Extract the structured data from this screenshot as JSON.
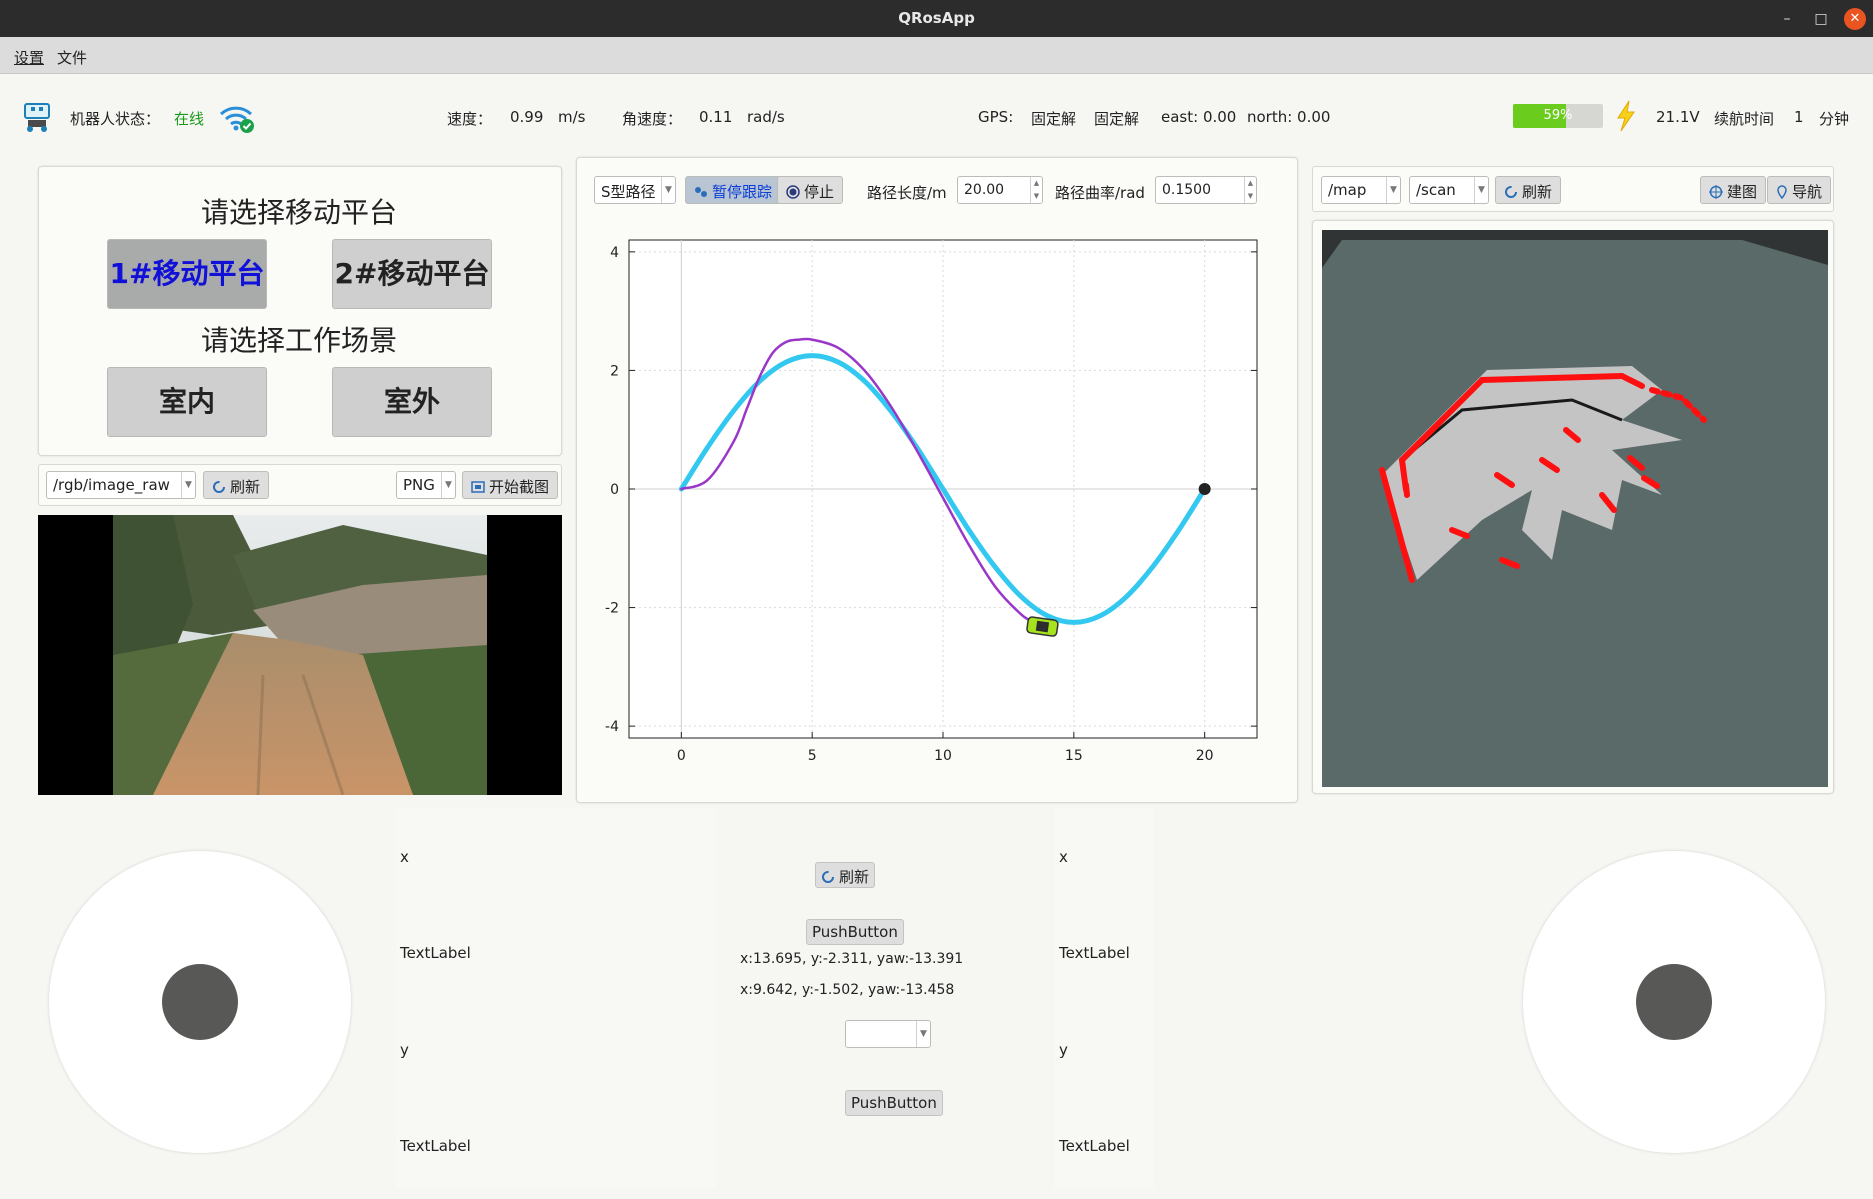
{
  "window": {
    "title": "QRosApp"
  },
  "menu": {
    "settings": "设置",
    "file": "文件"
  },
  "status": {
    "robot_state_label": "机器人状态：",
    "robot_state_value": "在线",
    "speed_label": "速度：",
    "speed_value": "0.99",
    "speed_unit": "m/s",
    "angular_label": "角速度：",
    "angular_value": "0.11",
    "angular_unit": "rad/s",
    "gps_label": "GPS:",
    "gps_fix1": "固定解",
    "gps_fix2": "固定解",
    "east": "east: 0.00",
    "north": "north: 0.00",
    "battery_percent": 59,
    "battery_text": "59%",
    "voltage": "21.1V",
    "endurance_label": "续航时间",
    "endurance_value": "1",
    "endurance_unit": "分钟",
    "online_color": "#1a9a1a",
    "battery_color": "#6acd1e"
  },
  "platform": {
    "heading": "请选择移动平台",
    "btn1": "1#移动平台",
    "btn2": "2#移动平台",
    "scene_heading": "请选择工作场景",
    "indoor": "室内",
    "outdoor": "室外"
  },
  "camera": {
    "topic": "/rgb/image_raw",
    "refresh": "刷新",
    "format": "PNG",
    "screenshot": "开始截图"
  },
  "path": {
    "type": "S型路径",
    "pause": "暂停跟踪",
    "stop": "停止",
    "length_label": "路径长度/m",
    "length_value": "20.00",
    "curvature_label": "路径曲率/rad",
    "curvature_value": "0.1500"
  },
  "chart_data": {
    "type": "line",
    "title": "",
    "xlabel": "",
    "ylabel": "",
    "xlim": [
      -2,
      22
    ],
    "ylim": [
      -4.2,
      4.2
    ],
    "xticks": [
      0,
      5,
      10,
      15,
      20
    ],
    "yticks": [
      4,
      2,
      0,
      -2,
      -4
    ],
    "xtick_labels": [
      "0",
      "5",
      "10",
      "15",
      "20"
    ],
    "ytick_labels": [
      "4",
      "2",
      "0",
      "-2",
      "-4"
    ],
    "grid": true,
    "series": [
      {
        "color": "#33c8f0",
        "x": [
          0,
          1,
          2,
          3,
          4,
          5,
          6,
          7,
          8,
          9,
          10,
          11,
          12,
          13,
          14,
          15,
          16,
          17,
          18,
          19,
          20
        ],
        "y": [
          0,
          0.7,
          1.32,
          1.82,
          2.14,
          2.25,
          2.14,
          1.82,
          1.32,
          0.7,
          0,
          -0.7,
          -1.32,
          -1.82,
          -2.14,
          -2.25,
          -2.14,
          -1.82,
          -1.32,
          -0.7,
          0
        ]
      },
      {
        "color": "#9a36c8",
        "x": [
          0,
          1,
          2,
          2.5,
          3,
          3.5,
          4,
          4.5,
          5,
          6,
          7,
          8,
          9,
          10,
          11,
          12,
          13,
          13.5
        ],
        "y": [
          0,
          0.15,
          0.8,
          1.35,
          1.9,
          2.3,
          2.48,
          2.52,
          2.52,
          2.38,
          2.0,
          1.4,
          0.65,
          -0.15,
          -0.95,
          -1.65,
          -2.12,
          -2.25
        ]
      }
    ],
    "points": [
      {
        "x": 20,
        "y": 0,
        "color": "#222222"
      },
      {
        "x": 13.8,
        "y": -2.32,
        "color": "#a6e21e",
        "label": "robot"
      }
    ]
  },
  "map": {
    "topic1": "/map",
    "topic2": "/scan",
    "refresh": "刷新",
    "build": "建图",
    "navigate": "导航",
    "bg_color": "#5a6a69"
  },
  "controls": {
    "x_left": "x",
    "label_left1": "TextLabel",
    "y_left": "y",
    "label_left2": "TextLabel",
    "x_right": "x",
    "label_right1": "TextLabel",
    "y_right": "y",
    "label_right2": "TextLabel",
    "refresh": "刷新",
    "pushbutton1": "PushButton",
    "pose1": "x:13.695, y:-2.311, yaw:-13.391",
    "pose2": "x:9.642, y:-1.502, yaw:-13.458",
    "pushbutton2": "PushButton"
  }
}
